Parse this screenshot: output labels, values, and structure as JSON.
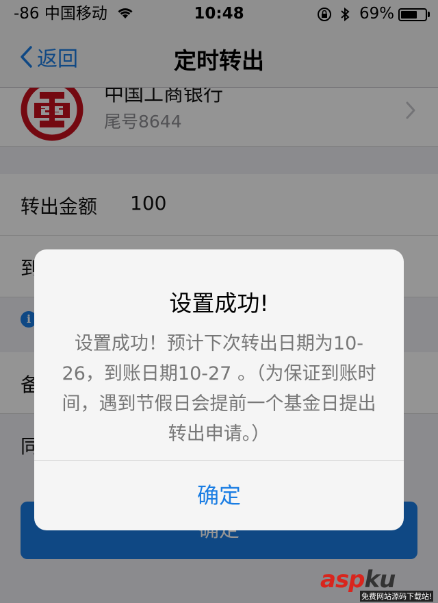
{
  "status_bar": {
    "carrier": "-86 中国移动",
    "time": "10:48",
    "battery_percent_label": "69%",
    "battery_level": 0.69,
    "icons": [
      "wifi-icon",
      "orientation-lock-icon",
      "bluetooth-icon",
      "battery-icon"
    ]
  },
  "nav": {
    "back_label": "返回",
    "title": "定时转出"
  },
  "bank": {
    "name": "中国工商银行",
    "tail_number": "尾号8644",
    "logo_color": "#c8101e"
  },
  "form": {
    "amount_label": "转出金额",
    "amount_value": "100",
    "row2_label_partial": "到",
    "row3_label_partial": "备",
    "row4_label_partial": "同",
    "confirm_label": "确定"
  },
  "alert": {
    "title": "设置成功!",
    "message": "设置成功！预计下次转出日期为10-26，到账日期10-27 。（为保证到账时间，遇到节假日会提前一个基金日提出转出申请。）",
    "ok_label": "确定"
  },
  "watermark": {
    "logo_a": "asp",
    "logo_b": "ku",
    "logo_tld": ".com",
    "tagline": "免费网站源码下载站!"
  },
  "colors": {
    "accent": "#1a7de3",
    "background": "#efeff4",
    "bank_red": "#c8101e"
  }
}
